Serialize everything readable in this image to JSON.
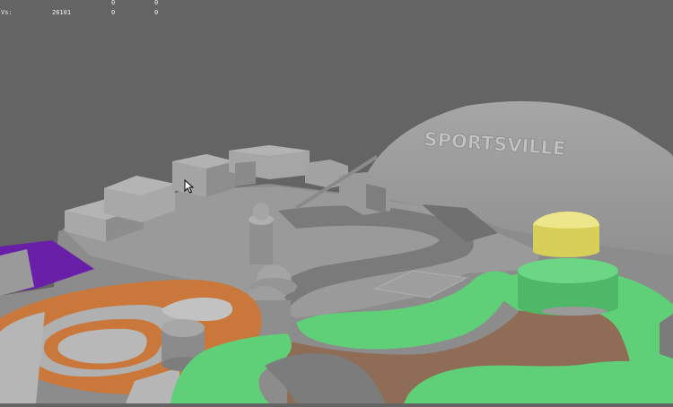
{
  "stats": {
    "rows": [
      {
        "label": "",
        "v1": "",
        "v2": "0",
        "v3": "0"
      },
      {
        "label": "Vs:",
        "v1": "26101",
        "v2": "0",
        "v3": "0"
      }
    ]
  },
  "scene": {
    "sign_text": "SPORTSVILLE"
  },
  "colors": {
    "background": "#646464",
    "buildings": "#9a9a9a",
    "grass": "#5fcf78",
    "dirt": "#8f6c55",
    "track": "#c9773a",
    "yellow_tank": "#e8de6a",
    "purple": "#6a1fa8"
  },
  "icons": {
    "cursor": "arrow-cursor-icon"
  }
}
